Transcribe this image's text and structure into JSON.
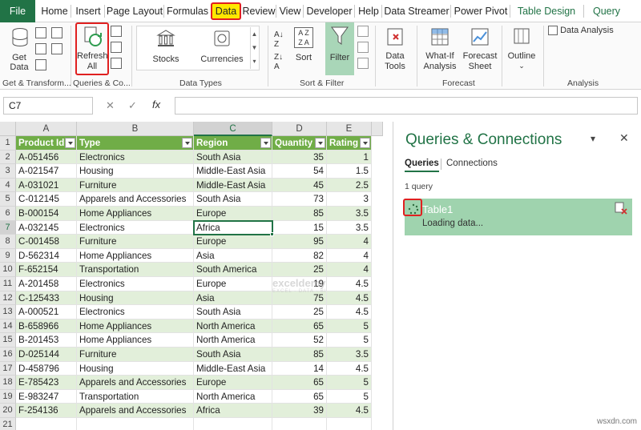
{
  "menu": {
    "file": "File",
    "home": "Home",
    "insert": "Insert",
    "page_layout": "Page Layout",
    "formulas": "Formulas",
    "data": "Data",
    "review": "Review",
    "view": "View",
    "developer": "Developer",
    "help": "Help",
    "data_streamer": "Data Streamer",
    "power_pivot": "Power Pivot",
    "table_design": "Table Design",
    "query": "Query"
  },
  "ribbon": {
    "get_data": "Get Data",
    "get_data_arrow": "⌄",
    "refresh_line1": "Refresh",
    "refresh_line2": "All",
    "stocks": "Stocks",
    "currencies": "Currencies",
    "sort": "Sort",
    "filter": "Filter",
    "data_tools_line1": "Data",
    "data_tools_line2": "Tools",
    "whatif_line1": "What-If",
    "whatif_line2": "Analysis",
    "forecast_line1": "Forecast",
    "forecast_line2": "Sheet",
    "outline": "Outline",
    "data_analysis": "Data Analysis",
    "groups": {
      "get_transform": "Get & Transform...",
      "queries_connections": "Queries & Co...",
      "data_types": "Data Types",
      "sort_filter": "Sort & Filter",
      "forecast": "Forecast",
      "analysis": "Analysis"
    }
  },
  "formula_bar": {
    "name_box": "C7",
    "fx": "fx",
    "cancel": "✕",
    "enter": "✓"
  },
  "grid": {
    "columns": [
      "A",
      "B",
      "C",
      "D",
      "E"
    ],
    "headers": [
      "Product Id",
      "Type",
      "Region",
      "Quantity",
      "Rating"
    ],
    "row_numbers": [
      "1",
      "2",
      "3",
      "4",
      "5",
      "6",
      "7",
      "8",
      "9",
      "10",
      "11",
      "12",
      "13",
      "14",
      "15",
      "16",
      "17",
      "18",
      "19",
      "20",
      "21"
    ],
    "rows": [
      [
        "A-051456",
        "Electronics",
        "South Asia",
        "35",
        "1"
      ],
      [
        "A-021547",
        "Housing",
        "Middle-East Asia",
        "54",
        "1.5"
      ],
      [
        "A-031021",
        "Furniture",
        "Middle-East Asia",
        "45",
        "2.5"
      ],
      [
        "C-012145",
        "Apparels and Accessories",
        "South Asia",
        "73",
        "3"
      ],
      [
        "B-000154",
        "Home Appliances",
        "Europe",
        "85",
        "3.5"
      ],
      [
        "A-032145",
        "Electronics",
        "Africa",
        "15",
        "3.5"
      ],
      [
        "C-001458",
        "Furniture",
        "Europe",
        "95",
        "4"
      ],
      [
        "D-562314",
        "Home Appliances",
        "Asia",
        "82",
        "4"
      ],
      [
        "F-652154",
        "Transportation",
        "South America",
        "25",
        "4"
      ],
      [
        "A-201458",
        "Electronics",
        "Europe",
        "19",
        "4.5"
      ],
      [
        "C-125433",
        "Housing",
        "Asia",
        "75",
        "4.5"
      ],
      [
        "A-000521",
        "Electronics",
        "South Asia",
        "25",
        "4.5"
      ],
      [
        "B-658966",
        "Home Appliances",
        "North America",
        "65",
        "5"
      ],
      [
        "B-201453",
        "Home Appliances",
        "North America",
        "52",
        "5"
      ],
      [
        "D-025144",
        "Furniture",
        "South Asia",
        "85",
        "3.5"
      ],
      [
        "D-458796",
        "Housing",
        "Middle-East Asia",
        "14",
        "4.5"
      ],
      [
        "E-785423",
        "Apparels and Accessories",
        "Europe",
        "65",
        "5"
      ],
      [
        "E-983247",
        "Transportation",
        "North America",
        "65",
        "5"
      ],
      [
        "F-254136",
        "Apparels and Accessories",
        "Africa",
        "39",
        "4.5"
      ]
    ]
  },
  "pane": {
    "title": "Queries & Connections",
    "tab_queries": "Queries",
    "tab_connections": "Connections",
    "count": "1 query",
    "query_name": "Table1",
    "query_status": "Loading data...",
    "close": "✕",
    "options": "▾"
  },
  "watermark": {
    "brand": "exceldemy",
    "tagline": "EXCEL · DATA · BI"
  },
  "site_mark": "wsxdn.com",
  "colors": {
    "excel_green": "#217346",
    "table_header": "#70ad47",
    "band": "#e2efda",
    "highlight_red": "#e02020",
    "highlight_yellow": "#ffe800"
  }
}
